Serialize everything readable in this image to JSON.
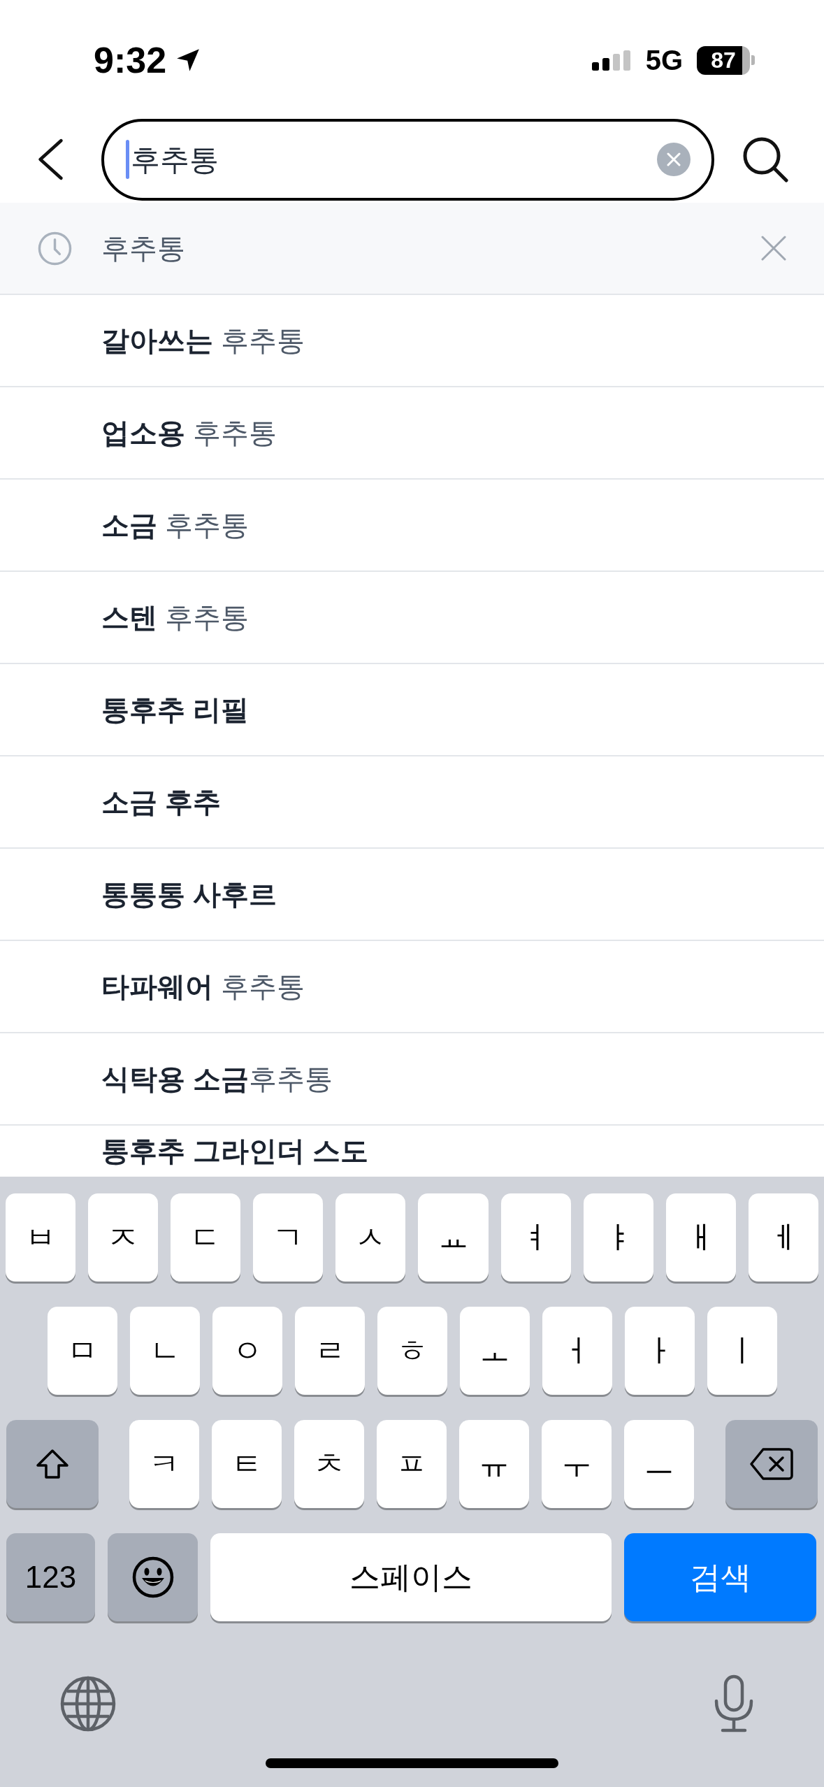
{
  "status_bar": {
    "time": "9:32",
    "network": "5G",
    "battery": "87"
  },
  "search": {
    "value": "후추통",
    "focused": true
  },
  "recent": [
    {
      "text": "후추통"
    }
  ],
  "suggestions": [
    {
      "kind": "partial",
      "text": "**갈아쓰는** 후추통"
    },
    {
      "kind": "partial",
      "text": "**업소용** 후추통"
    },
    {
      "kind": "partial",
      "text": "**소금** 후추통"
    },
    {
      "kind": "partial",
      "text": "**스텐** 후추통"
    },
    {
      "kind": "full",
      "text": "통후추 리필"
    },
    {
      "kind": "full",
      "text": "소금 후추"
    },
    {
      "kind": "full",
      "text": "통통통 사후르"
    },
    {
      "kind": "partial",
      "text": "**타파웨어** 후추통"
    },
    {
      "kind": "partial",
      "text": "**식탁용 소금**후추통"
    },
    {
      "kind": "full",
      "text": "통후추 그라인더 스도"
    }
  ],
  "keyboard": {
    "letter_rows": [
      [
        "ㅂ",
        "ㅈ",
        "ㄷ",
        "ㄱ",
        "ㅅ",
        "ㅛ",
        "ㅕ",
        "ㅑ",
        "ㅐ",
        "ㅔ"
      ],
      [
        "ㅁ",
        "ㄴ",
        "ㅇ",
        "ㄹ",
        "ㅎ",
        "ㅗ",
        "ㅓ",
        "ㅏ",
        "ㅣ"
      ],
      [
        "ㅋ",
        "ㅌ",
        "ㅊ",
        "ㅍ",
        "ㅠ",
        "ㅜ",
        "ㅡ"
      ]
    ],
    "number_key": "123",
    "space_key": "스페이스",
    "return_key": "검색"
  }
}
